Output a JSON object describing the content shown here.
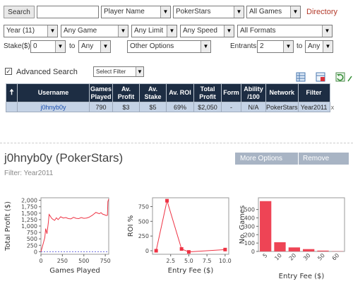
{
  "search": {
    "button": "Search",
    "query": "",
    "type_select": "Player Name",
    "site_select": "PokerStars",
    "games_select": "All Games",
    "directory_link": "Directory"
  },
  "filters": {
    "year": "Year (11)",
    "game": "Any Game",
    "limit": "Any Limit",
    "speed": "Any Speed",
    "formats": "All Formats",
    "stake_label": "Stake($)",
    "stake_min": "0",
    "to_label": "to",
    "stake_max": "Any",
    "other_options": "Other Options",
    "entrants_label": "Entrants",
    "entrants_min": "2",
    "entrants_to": "to",
    "entrants_max": "Any"
  },
  "advanced": {
    "label": "Advanced Search",
    "checked": true,
    "select_filter": "Select Filter"
  },
  "table": {
    "headers": [
      "Username",
      "Games Played",
      "Av. Profit",
      "Av. Stake",
      "Av. ROI",
      "Total Profit",
      "Form",
      "Ability /100",
      "Network",
      "Filter"
    ],
    "row": [
      "j0hnyb0y",
      "790",
      "$3",
      "$5",
      "69%",
      "$2,050",
      "-",
      "N/A",
      "PokerStars",
      "Year2011"
    ],
    "remove_glyph": "x"
  },
  "profile": {
    "title": "j0hnyb0y (PokerStars)",
    "filter": "Filter: Year2011",
    "more_options": "More Options",
    "remove": "Remove"
  },
  "chart_data": [
    {
      "type": "line",
      "xlabel": "Games Played",
      "ylabel": "Total Profit ($)",
      "xlim": [
        0,
        790
      ],
      "ylim": [
        -100,
        2100
      ],
      "xticks": [
        "0",
        "250",
        "500",
        "750"
      ],
      "yticks": [
        "0",
        "250",
        "500",
        "750",
        "1,000",
        "1,250",
        "1,500",
        "1,750",
        "2,000"
      ],
      "color": "#ee3344",
      "x": [
        0,
        25,
        45,
        55,
        70,
        85,
        95,
        110,
        125,
        140,
        160,
        180,
        200,
        230,
        260,
        290,
        320,
        350,
        380,
        410,
        440,
        470,
        500,
        530,
        560,
        600,
        640,
        680,
        700,
        720,
        740,
        760,
        775,
        780,
        790
      ],
      "y": [
        0,
        300,
        550,
        900,
        700,
        1100,
        1450,
        1380,
        1300,
        1260,
        1220,
        1320,
        1250,
        1360,
        1310,
        1330,
        1290,
        1280,
        1340,
        1300,
        1290,
        1330,
        1300,
        1310,
        1340,
        1420,
        1530,
        1480,
        1520,
        1460,
        1440,
        1410,
        1420,
        1950,
        2050
      ]
    },
    {
      "type": "line",
      "xlabel": "Entry Fee ($)",
      "ylabel": "ROI %",
      "xlim": [
        0,
        10.5
      ],
      "ylim": [
        -60,
        900
      ],
      "xticks": [
        "2.5",
        "5.0",
        "7.5",
        "10.0"
      ],
      "yticks": [
        "0",
        "250",
        "500",
        "750"
      ],
      "color": "#ee3344",
      "x": [
        0.5,
        2,
        4,
        5,
        10
      ],
      "y": [
        0,
        850,
        30,
        -20,
        20
      ]
    },
    {
      "type": "bar",
      "xlabel": "Entry Fee ($)",
      "ylabel": "No. Games",
      "ylim": [
        0,
        640
      ],
      "yticks": [
        "0",
        "100",
        "200",
        "300",
        "400",
        "500"
      ],
      "color": "#ee4455",
      "categories": [
        "5",
        "10",
        "20",
        "30",
        "50",
        "60"
      ],
      "values": [
        600,
        110,
        48,
        28,
        10,
        3
      ]
    }
  ]
}
